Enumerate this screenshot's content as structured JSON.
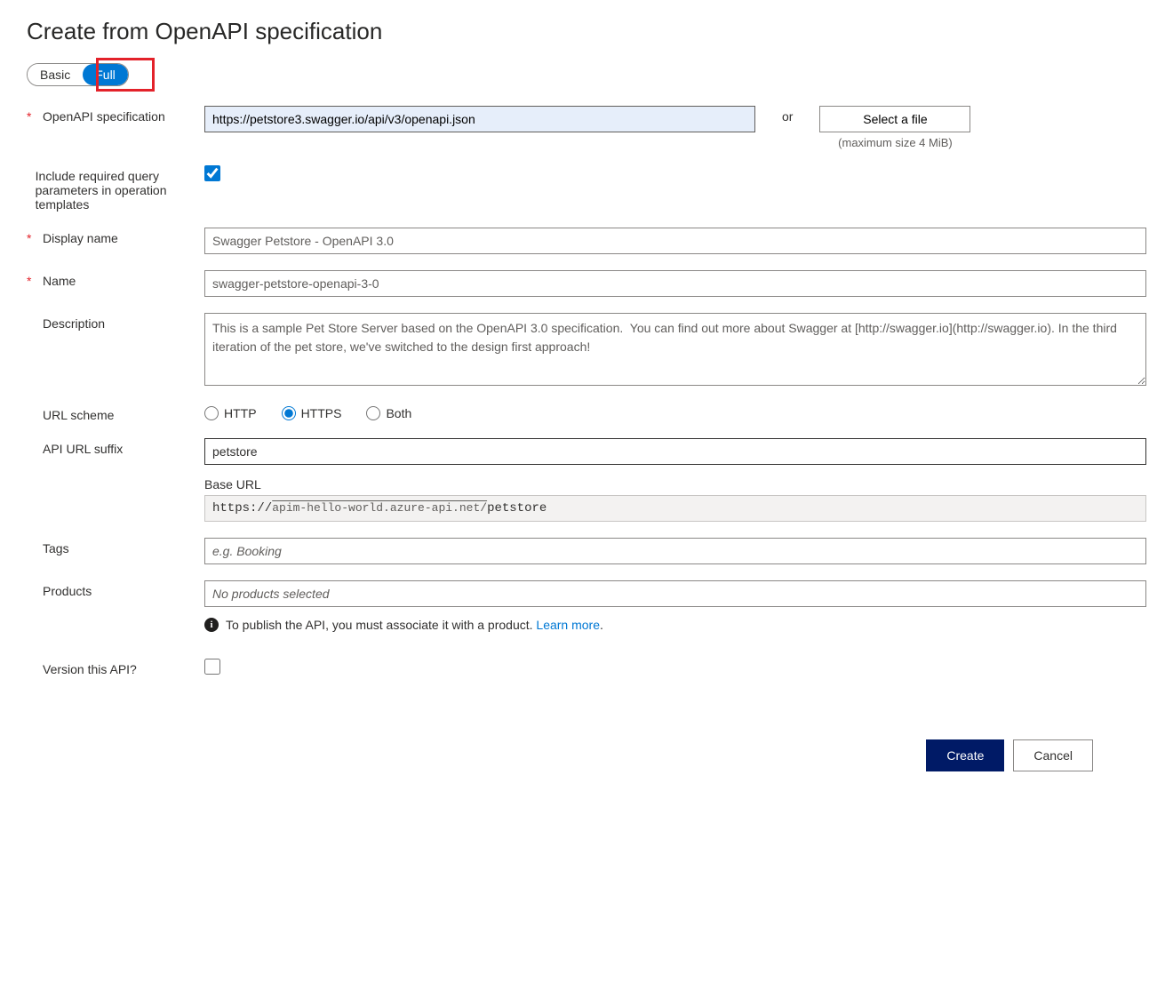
{
  "heading": "Create from OpenAPI specification",
  "toggle": {
    "basic": "Basic",
    "full": "Full"
  },
  "labels": {
    "openapi_spec": "OpenAPI specification",
    "include_required": "Include required query parameters in operation templates",
    "display_name": "Display name",
    "name": "Name",
    "description": "Description",
    "url_scheme": "URL scheme",
    "api_url_suffix": "API URL suffix",
    "base_url": "Base URL",
    "tags": "Tags",
    "products": "Products",
    "version_api": "Version this API?"
  },
  "values": {
    "openapi_spec": "https://petstore3.swagger.io/api/v3/openapi.json",
    "display_name": "Swagger Petstore - OpenAPI 3.0",
    "name": "swagger-petstore-openapi-3-0",
    "description": "This is a sample Pet Store Server based on the OpenAPI 3.0 specification.  You can find out more about Swagger at [http://swagger.io](http://swagger.io). In the third iteration of the pet store, we've switched to the design first approach!",
    "api_url_suffix": "petstore",
    "base_url_scheme": "https://",
    "base_url_host": "apim-hello-world.azure-api.net/",
    "base_url_suffix": "petstore",
    "products": "No products selected"
  },
  "placeholders": {
    "tags": "e.g. Booking"
  },
  "or_text": "or",
  "select_file": "Select a file",
  "file_hint": "(maximum size 4 MiB)",
  "url_scheme_options": {
    "http": "HTTP",
    "https": "HTTPS",
    "both": "Both"
  },
  "info_text": "To publish the API, you must associate it with a product. ",
  "learn_more": "Learn more",
  "buttons": {
    "create": "Create",
    "cancel": "Cancel"
  }
}
